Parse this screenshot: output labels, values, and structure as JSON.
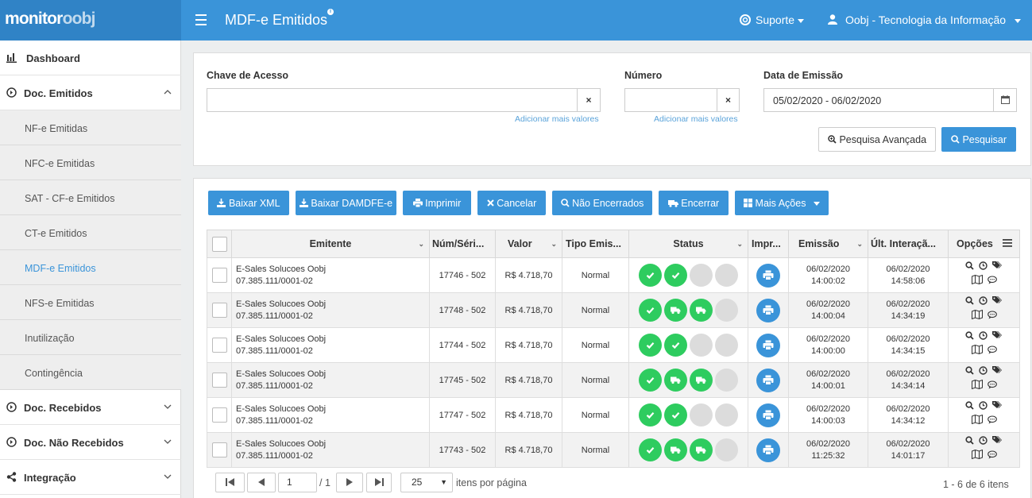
{
  "header": {
    "brand_a": "monitor",
    "brand_b": "oobj",
    "title": "MDF-e Emitidos",
    "support": "Suporte",
    "user": "Oobj - Tecnologia da Informação"
  },
  "sidebar": {
    "dashboard": "Dashboard",
    "doc_emitidos": "Doc. Emitidos",
    "sub": [
      "NF-e Emitidas",
      "NFC-e Emitidas",
      "SAT - CF-e Emitidos",
      "CT-e Emitidos",
      "MDF-e Emitidos",
      "NFS-e Emitidas",
      "Inutilização",
      "Contingência"
    ],
    "doc_recebidos": "Doc. Recebidos",
    "doc_nao_recebidos": "Doc. Não Recebidos",
    "integracao": "Integração"
  },
  "filters": {
    "chave_label": "Chave de Acesso",
    "chave_value": "",
    "numero_label": "Número",
    "numero_value": "",
    "data_label": "Data de Emissão",
    "data_value": "05/02/2020 - 06/02/2020",
    "add_more": "Adicionar mais valores",
    "clear": "×",
    "advanced": "Pesquisa Avançada",
    "search": "Pesquisar"
  },
  "actions": {
    "baixar_xml": "Baixar XML",
    "baixar_damdfe": "Baixar DAMDFE-e",
    "imprimir": "Imprimir",
    "cancelar": "Cancelar",
    "nao_encerrados": "Não Encerrados",
    "encerrar": "Encerrar",
    "mais_acoes": "Mais Ações"
  },
  "table": {
    "headers": [
      "Emitente",
      "Núm/Séri...",
      "Valor",
      "Tipo Emis...",
      "Status",
      "Impr...",
      "Emissão",
      "Últ. Interaçã...",
      "Opções"
    ],
    "rows": [
      {
        "emitente": "E-Sales Solucoes Oobj",
        "cnpj": "07.385.111/0001-02",
        "num": "17746 - 502",
        "valor": "R$ 4.718,70",
        "tipo": "Normal",
        "status": [
          "check",
          "check",
          "",
          ""
        ],
        "emissao_d": "06/02/2020",
        "emissao_h": "14:00:02",
        "ult_d": "06/02/2020",
        "ult_h": "14:58:06"
      },
      {
        "emitente": "E-Sales Solucoes Oobj",
        "cnpj": "07.385.111/0001-02",
        "num": "17748 - 502",
        "valor": "R$ 4.718,70",
        "tipo": "Normal",
        "status": [
          "check",
          "truck",
          "truck",
          ""
        ],
        "emissao_d": "06/02/2020",
        "emissao_h": "14:00:04",
        "ult_d": "06/02/2020",
        "ult_h": "14:34:19"
      },
      {
        "emitente": "E-Sales Solucoes Oobj",
        "cnpj": "07.385.111/0001-02",
        "num": "17744 - 502",
        "valor": "R$ 4.718,70",
        "tipo": "Normal",
        "status": [
          "check",
          "check",
          "",
          ""
        ],
        "emissao_d": "06/02/2020",
        "emissao_h": "14:00:00",
        "ult_d": "06/02/2020",
        "ult_h": "14:34:15"
      },
      {
        "emitente": "E-Sales Solucoes Oobj",
        "cnpj": "07.385.111/0001-02",
        "num": "17745 - 502",
        "valor": "R$ 4.718,70",
        "tipo": "Normal",
        "status": [
          "check",
          "truck",
          "truck",
          ""
        ],
        "emissao_d": "06/02/2020",
        "emissao_h": "14:00:01",
        "ult_d": "06/02/2020",
        "ult_h": "14:34:14"
      },
      {
        "emitente": "E-Sales Solucoes Oobj",
        "cnpj": "07.385.111/0001-02",
        "num": "17747 - 502",
        "valor": "R$ 4.718,70",
        "tipo": "Normal",
        "status": [
          "check",
          "check",
          "",
          ""
        ],
        "emissao_d": "06/02/2020",
        "emissao_h": "14:00:03",
        "ult_d": "06/02/2020",
        "ult_h": "14:34:12"
      },
      {
        "emitente": "E-Sales Solucoes Oobj",
        "cnpj": "07.385.111/0001-02",
        "num": "17743 - 502",
        "valor": "R$ 4.718,70",
        "tipo": "Normal",
        "status": [
          "check",
          "truck",
          "truck",
          ""
        ],
        "emissao_d": "06/02/2020",
        "emissao_h": "11:25:32",
        "ult_d": "06/02/2020",
        "ult_h": "14:01:17"
      }
    ]
  },
  "pagination": {
    "page": "1",
    "of": "/ 1",
    "per_page": "25",
    "per_page_label": "itens por página",
    "summary": "1 - 6 de 6 itens"
  },
  "colors": {
    "accent": "#3a94d9",
    "success": "#2ecc5f",
    "inactive": "#dcdcdc"
  }
}
